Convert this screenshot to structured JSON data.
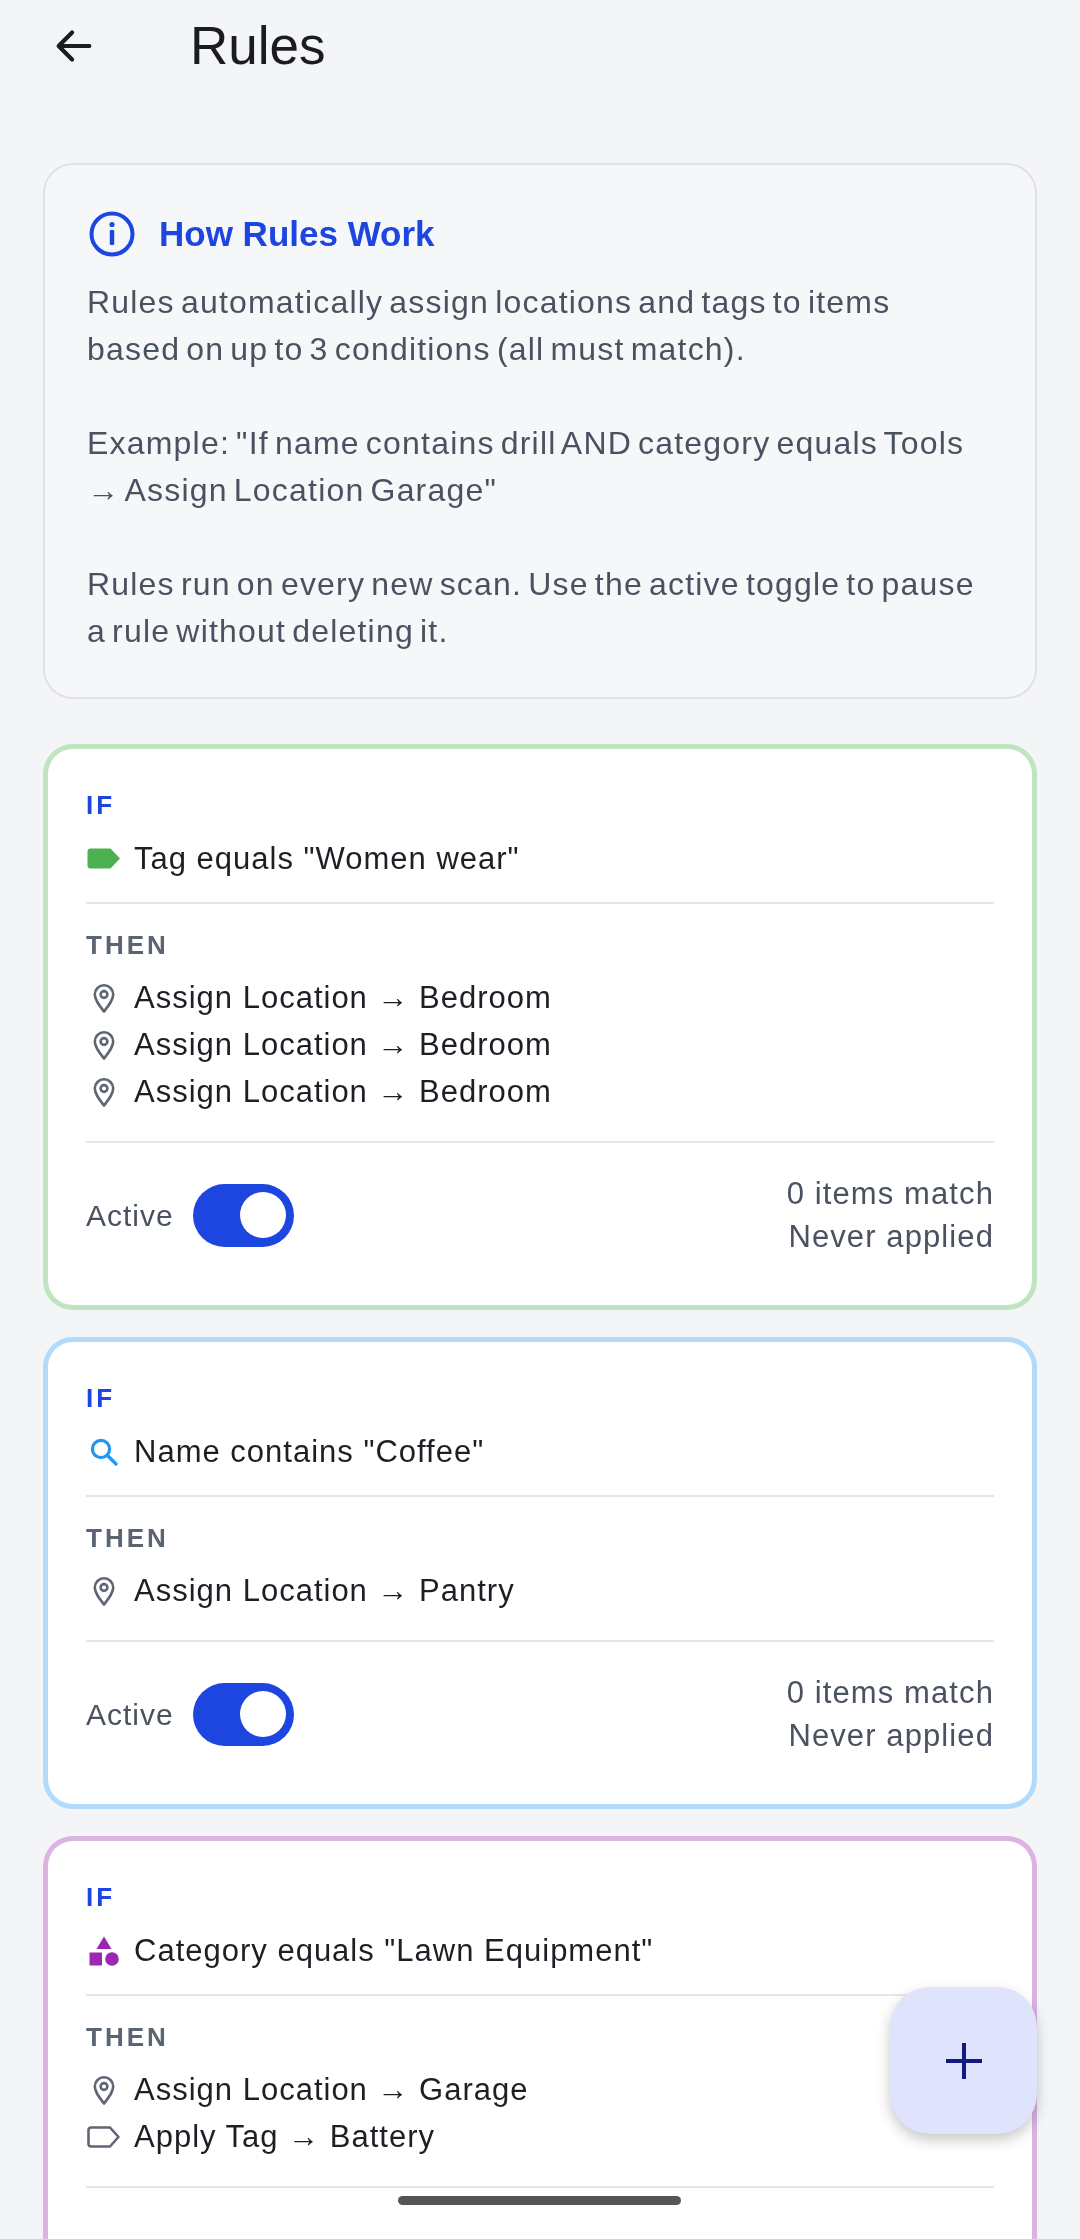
{
  "header": {
    "title": "Rules"
  },
  "info": {
    "title": "How Rules Work",
    "paragraphs": [
      "Rules automatically assign locations and tags to items based on up to 3 conditions (all must match).",
      "Example: \"If name contains drill AND category equals Tools → Assign Location Garage\"",
      "Rules run on every new scan. Use the active toggle to pause a rule without deleting it."
    ]
  },
  "rules": [
    {
      "color": "#4caf50",
      "if_label": "IF",
      "conditions": [
        {
          "kind": "tag",
          "text": "Tag equals \"Women wear\""
        }
      ],
      "then_label": "THEN",
      "actions": [
        {
          "kind": "location",
          "text": "Assign Location → Bedroom"
        },
        {
          "kind": "location",
          "text": "Assign Location → Bedroom"
        },
        {
          "kind": "location",
          "text": "Assign Location → Bedroom"
        }
      ],
      "footer": {
        "label": "Active",
        "on": true,
        "match_count": "0 items match",
        "last_applied": "Never applied"
      }
    },
    {
      "color": "#2196f3",
      "if_label": "IF",
      "conditions": [
        {
          "kind": "name",
          "text": "Name contains \"Coffee\""
        }
      ],
      "then_label": "THEN",
      "actions": [
        {
          "kind": "location",
          "text": "Assign Location → Pantry"
        }
      ],
      "footer": {
        "label": "Active",
        "on": true,
        "match_count": "0 items match",
        "last_applied": "Never applied"
      }
    },
    {
      "color": "#9c27b0",
      "if_label": "IF",
      "conditions": [
        {
          "kind": "category",
          "text": "Category equals \"Lawn Equipment\""
        }
      ],
      "then_label": "THEN",
      "actions": [
        {
          "kind": "location",
          "text": "Assign Location → Garage"
        },
        {
          "kind": "tag",
          "text": "Apply Tag → Battery"
        }
      ]
    }
  ]
}
